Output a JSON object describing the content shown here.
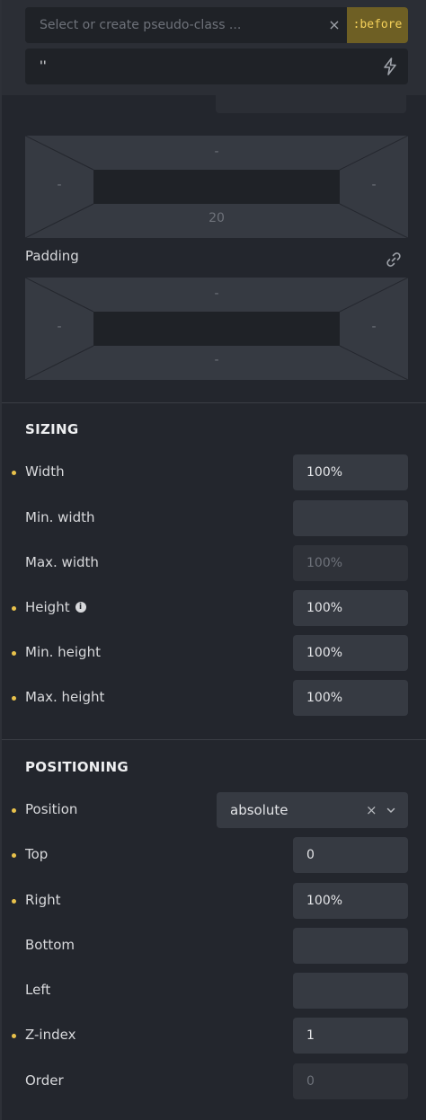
{
  "pseudo": {
    "placeholder": "Select or create pseudo-class ...",
    "clear_icon": "×",
    "badge": ":before"
  },
  "content": {
    "value": "''",
    "icon": "bolt-icon"
  },
  "margin_box": {
    "top": "-",
    "left": "-",
    "right": "-",
    "bottom": "20"
  },
  "padding": {
    "label": "Padding",
    "icon": "link-icon",
    "box": {
      "top": "-",
      "left": "-",
      "right": "-",
      "bottom": "-"
    }
  },
  "sizing": {
    "title": "SIZING",
    "rows": [
      {
        "label": "Width",
        "value": "100%",
        "set": true
      },
      {
        "label": "Min. width",
        "value": "",
        "set": false
      },
      {
        "label": "Max. width",
        "value": "100%",
        "placeholder": true,
        "set": false
      },
      {
        "label": "Height",
        "value": "100%",
        "set": true,
        "info": "i"
      },
      {
        "label": "Min. height",
        "value": "100%",
        "set": true
      },
      {
        "label": "Max. height",
        "value": "100%",
        "set": true
      }
    ]
  },
  "positioning": {
    "title": "POSITIONING",
    "position": {
      "label": "Position",
      "value": "absolute",
      "clear": "×"
    },
    "rows": [
      {
        "label": "Top",
        "value": "0",
        "set": true
      },
      {
        "label": "Right",
        "value": "100%",
        "set": true
      },
      {
        "label": "Bottom",
        "value": "",
        "set": false
      },
      {
        "label": "Left",
        "value": "",
        "set": false
      },
      {
        "label": "Z-index",
        "value": "1",
        "set": true
      },
      {
        "label": "Order",
        "value": "0",
        "placeholder": true,
        "set": false
      }
    ]
  },
  "colors": {
    "accent": "#e9c24b",
    "badge_bg": "#6e5f24",
    "panel_bg": "#23262d"
  }
}
